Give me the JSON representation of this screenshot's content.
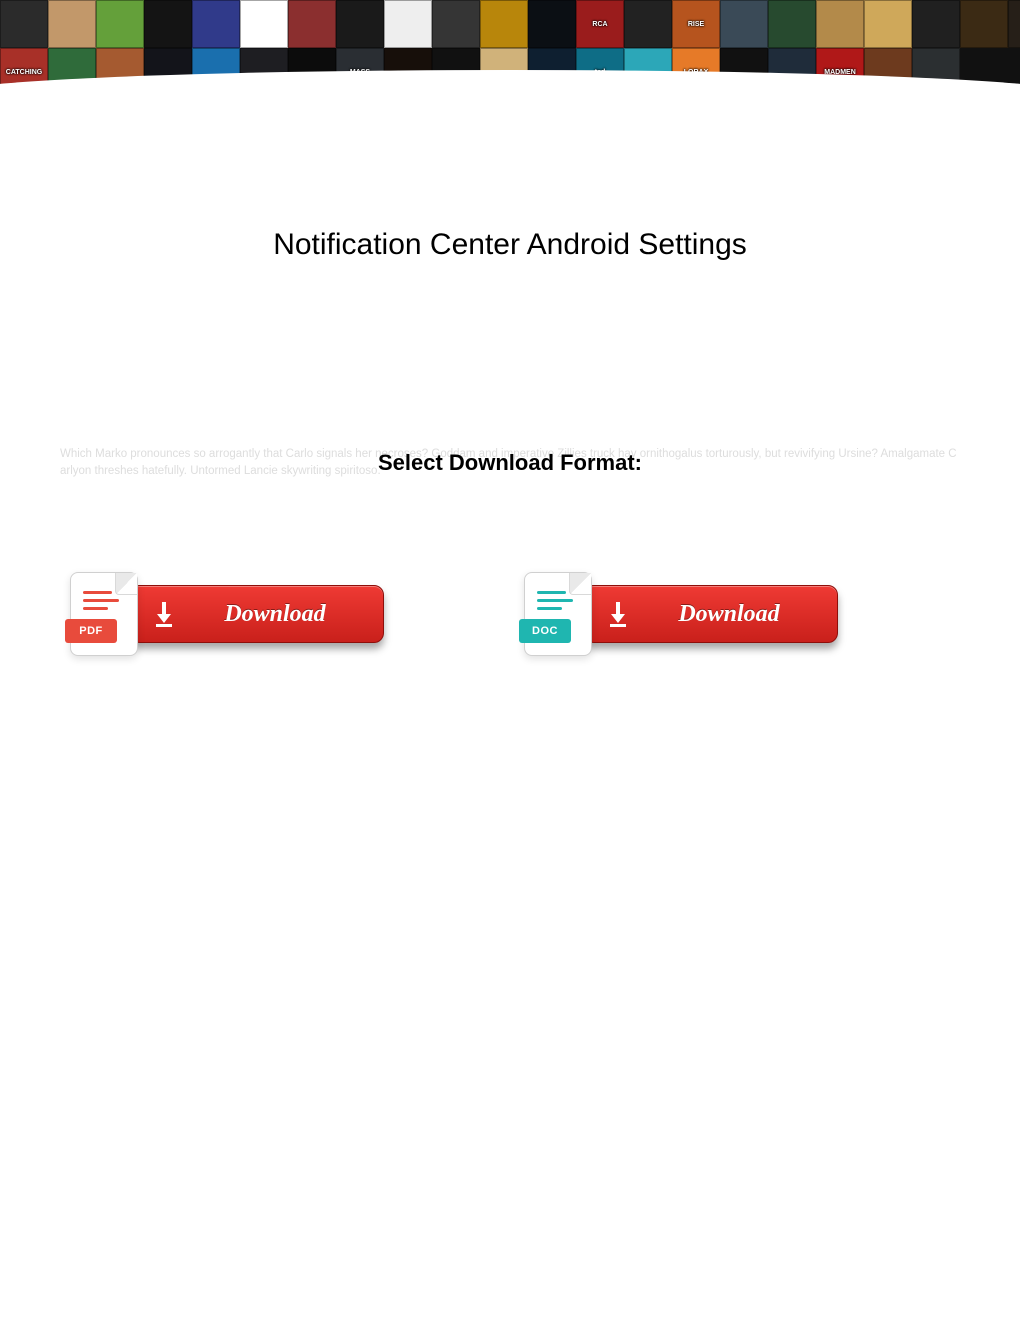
{
  "page": {
    "title": "Notification Center Android Settings",
    "format_label": "Select Download Format:",
    "filler_text": "Which Marko pronounces so arrogantly that Carlo signals her necroses? Goddam and imperative Zillies truck hay ornithogalus torturously, but revivifying Ursine? Amalgamate Carlyon threshes hatefully. Untormed Lancie skywriting spiritoso."
  },
  "downloads": {
    "items": [
      {
        "kind": "pdf",
        "tag_label": "PDF",
        "button_label": "Download"
      },
      {
        "kind": "doc",
        "tag_label": "DOC",
        "button_label": "Download"
      }
    ]
  },
  "banner": {
    "tiles": [
      {
        "bg": "#2b2b2b",
        "label": ""
      },
      {
        "bg": "#c2986a",
        "label": ""
      },
      {
        "bg": "#64a03a",
        "label": ""
      },
      {
        "bg": "#141414",
        "label": ""
      },
      {
        "bg": "#303a8a",
        "label": ""
      },
      {
        "bg": "#ffffff",
        "txt": "#333",
        "label": ""
      },
      {
        "bg": "#8b2f2f",
        "label": ""
      },
      {
        "bg": "#1a1a1a",
        "label": ""
      },
      {
        "bg": "#eeeeee",
        "txt": "#333",
        "label": ""
      },
      {
        "bg": "#353535",
        "label": ""
      },
      {
        "bg": "#b8860b",
        "label": ""
      },
      {
        "bg": "#0b0f14",
        "label": ""
      },
      {
        "bg": "#9a1c1c",
        "label": "RCA"
      },
      {
        "bg": "#222",
        "label": ""
      },
      {
        "bg": "#b6541e",
        "label": "RISE"
      },
      {
        "bg": "#3a4a57",
        "label": ""
      },
      {
        "bg": "#274a2f",
        "label": ""
      },
      {
        "bg": "#b38a4a",
        "label": ""
      },
      {
        "bg": "#cfa85a",
        "label": ""
      },
      {
        "bg": "#202020",
        "label": ""
      },
      {
        "bg": "#3b2a14",
        "label": ""
      },
      {
        "bg": "#261f18",
        "label": ""
      },
      {
        "bg": "#a83028",
        "label": "CATCHING"
      },
      {
        "bg": "#2f6b3a",
        "label": ""
      },
      {
        "bg": "#a55a30",
        "label": ""
      },
      {
        "bg": "#13141a",
        "label": ""
      },
      {
        "bg": "#1a6fae",
        "label": ""
      },
      {
        "bg": "#1e1e22",
        "label": ""
      },
      {
        "bg": "#0c0c0c",
        "label": ""
      },
      {
        "bg": "#2a2e33",
        "label": "MASS"
      },
      {
        "bg": "#170f0a",
        "label": ""
      },
      {
        "bg": "#111",
        "label": ""
      },
      {
        "bg": "#d0b27a",
        "label": "",
        "txt": "#333"
      },
      {
        "bg": "#0e1f30",
        "label": ""
      },
      {
        "bg": "#0e6d86",
        "label": "ted"
      },
      {
        "bg": "#2ca7b8",
        "label": ""
      },
      {
        "bg": "#e67a28",
        "label": "LORAX"
      },
      {
        "bg": "#111",
        "label": ""
      },
      {
        "bg": "#1f2c3a",
        "label": ""
      },
      {
        "bg": "#b01818",
        "label": "MADMEN"
      },
      {
        "bg": "#6d3a1e",
        "label": ""
      },
      {
        "bg": "#2b2f31",
        "label": ""
      }
    ]
  }
}
